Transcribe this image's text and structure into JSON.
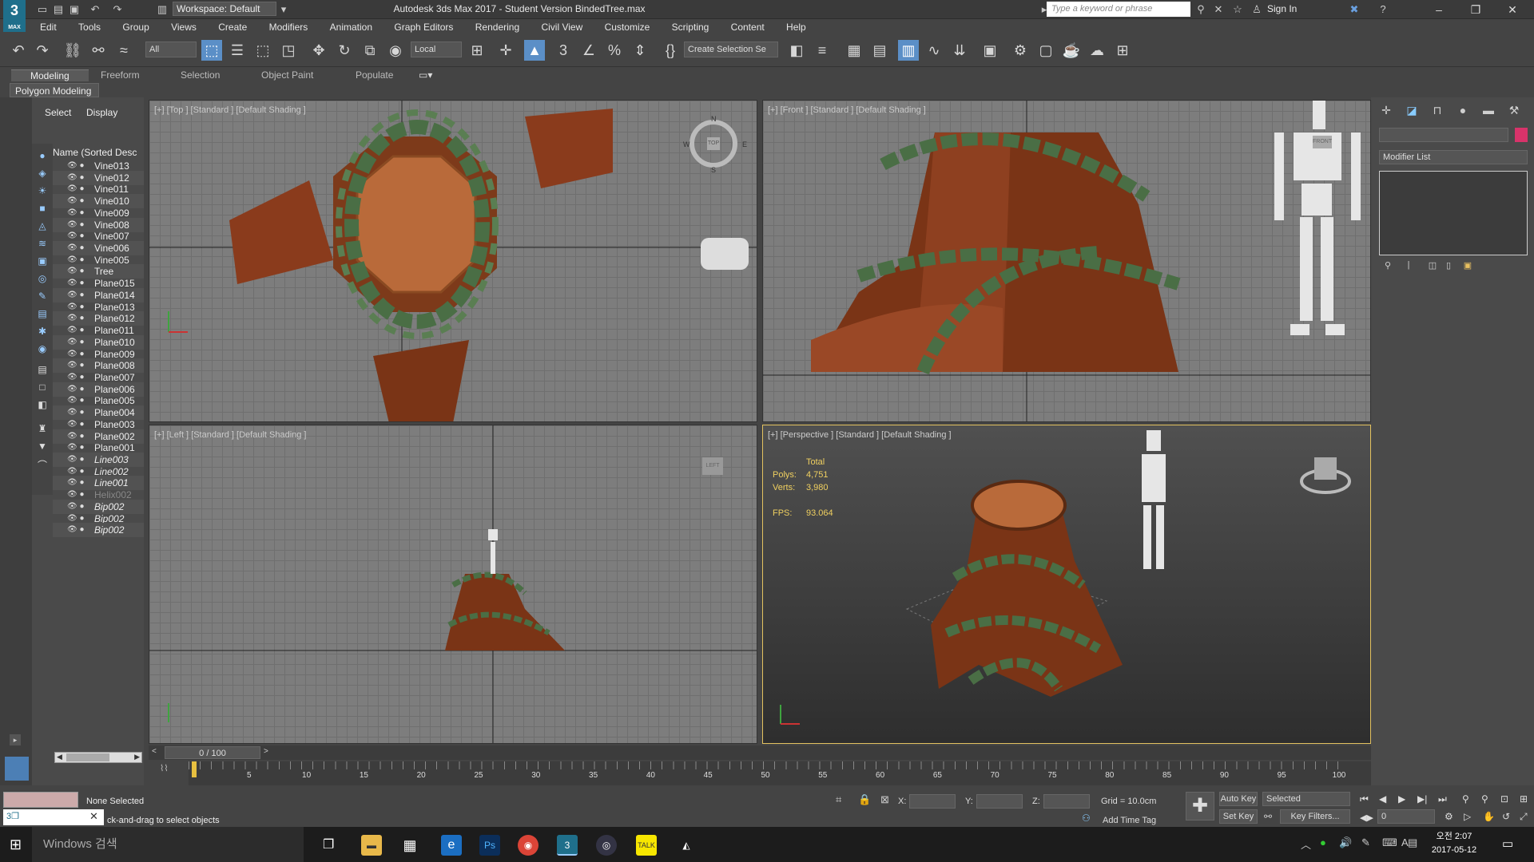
{
  "app": {
    "title": "Autodesk 3ds Max 2017 - Student Version    BindedTree.max",
    "logo_label": "MAX",
    "logo_digit": "3",
    "workspace": "Workspace: Default",
    "search_placeholder": "Type a keyword or phrase",
    "signin": "Sign In"
  },
  "menu": [
    "Edit",
    "Tools",
    "Group",
    "Views",
    "Create",
    "Modifiers",
    "Animation",
    "Graph Editors",
    "Rendering",
    "Civil View",
    "Customize",
    "Scripting",
    "Content",
    "Help"
  ],
  "toolbar": {
    "filter_value": "All",
    "coord_value": "Local",
    "selection_set": "Create Selection Se"
  },
  "ribbon": {
    "tabs": [
      "Modeling",
      "Freeform",
      "Selection",
      "Object Paint",
      "Populate"
    ],
    "panel": "Polygon Modeling"
  },
  "explorer": {
    "tabs": [
      "Select",
      "Display"
    ],
    "column_header": "Name (Sorted Desc",
    "rows": [
      {
        "name": "Vine013",
        "style": "normal"
      },
      {
        "name": "Vine012",
        "style": "normal"
      },
      {
        "name": "Vine011",
        "style": "normal"
      },
      {
        "name": "Vine010",
        "style": "normal"
      },
      {
        "name": "Vine009",
        "style": "normal"
      },
      {
        "name": "Vine008",
        "style": "normal"
      },
      {
        "name": "Vine007",
        "style": "normal"
      },
      {
        "name": "Vine006",
        "style": "normal"
      },
      {
        "name": "Vine005",
        "style": "normal"
      },
      {
        "name": "Tree",
        "style": "normal"
      },
      {
        "name": "Plane015",
        "style": "normal"
      },
      {
        "name": "Plane014",
        "style": "normal"
      },
      {
        "name": "Plane013",
        "style": "normal"
      },
      {
        "name": "Plane012",
        "style": "normal"
      },
      {
        "name": "Plane011",
        "style": "normal"
      },
      {
        "name": "Plane010",
        "style": "normal"
      },
      {
        "name": "Plane009",
        "style": "normal"
      },
      {
        "name": "Plane008",
        "style": "normal"
      },
      {
        "name": "Plane007",
        "style": "normal"
      },
      {
        "name": "Plane006",
        "style": "normal"
      },
      {
        "name": "Plane005",
        "style": "normal"
      },
      {
        "name": "Plane004",
        "style": "normal"
      },
      {
        "name": "Plane003",
        "style": "normal"
      },
      {
        "name": "Plane002",
        "style": "normal"
      },
      {
        "name": "Plane001",
        "style": "normal"
      },
      {
        "name": "Line003",
        "style": "italic"
      },
      {
        "name": "Line002",
        "style": "italic"
      },
      {
        "name": "Line001",
        "style": "italic"
      },
      {
        "name": "Helix002",
        "style": "dim"
      },
      {
        "name": "Bip002",
        "style": "italic"
      },
      {
        "name": "Bip002",
        "style": "italic"
      },
      {
        "name": "Bip002",
        "style": "italic"
      }
    ]
  },
  "viewports": {
    "top": "[+] [Top ] [Standard ] [Default Shading ]",
    "front": "[+] [Front ] [Standard ] [Default Shading ]",
    "left": "[+] [Left ] [Standard ] [Default Shading ]",
    "perspective": "[+] [Perspective ] [Standard ] [Default Shading ]",
    "compass": {
      "n": "N",
      "s": "S",
      "e": "E",
      "w": "W",
      "cube": "TOP"
    },
    "front_cube": "FRONT",
    "left_cube": "LEFT"
  },
  "stats": {
    "header": "Total",
    "polys_label": "Polys:",
    "polys": "4,751",
    "verts_label": "Verts:",
    "verts": "3,980",
    "fps_label": "FPS:",
    "fps": "93.064"
  },
  "command_panel": {
    "modifier_list": "Modifier List"
  },
  "timeline": {
    "slider": "0 / 100",
    "ticks": [
      5,
      10,
      15,
      20,
      25,
      30,
      35,
      40,
      45,
      50,
      55,
      60,
      65,
      70,
      75,
      80,
      85,
      90,
      95,
      100
    ]
  },
  "status": {
    "selection": "None Selected",
    "prompt": "ck-and-drag to select objects",
    "x_label": "X:",
    "y_label": "Y:",
    "z_label": "Z:",
    "grid": "Grid = 10.0cm",
    "add_time_tag": "Add Time Tag",
    "auto_key": "Auto Key",
    "set_key": "Set Key",
    "key_mode": "Selected",
    "key_filters": "Key Filters...",
    "frame": "0"
  },
  "taskbar": {
    "search": "Windows 검색",
    "time": "오전 2:07",
    "date": "2017-05-12"
  },
  "colors": {
    "accent": "#5b8fc7",
    "viewport_active": "#e3c260",
    "stat_text": "#f0d060",
    "wood": "#8a3b1c",
    "vine": "#4a6e45"
  }
}
